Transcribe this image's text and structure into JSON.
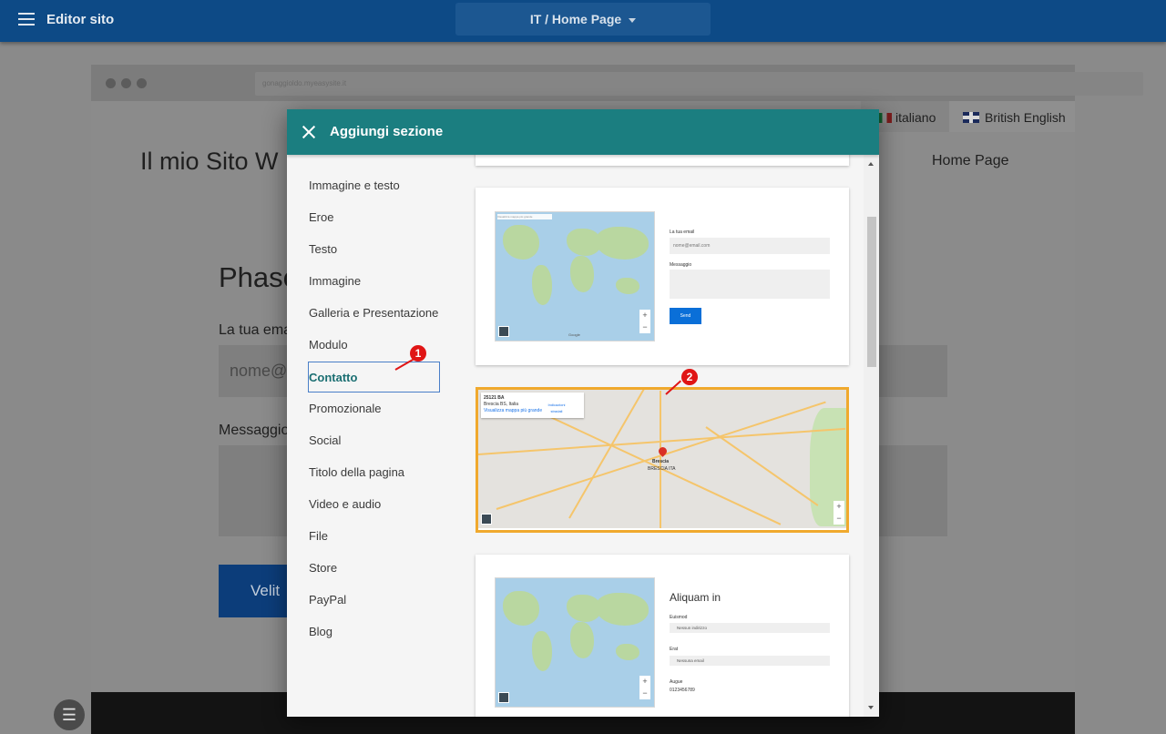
{
  "topbar": {
    "app_title": "Editor sito",
    "page_selector": "IT / Home Page"
  },
  "background": {
    "url": "gonaggioldo.myeasysite.it",
    "languages": [
      "italiano",
      "British English"
    ],
    "site_title": "Il mio Sito W",
    "nav_item": "Home Page",
    "heading": "Phase",
    "email_label": "La tua ema",
    "email_placeholder": "nome@",
    "message_label": "Messaggio",
    "button_label": "Velit"
  },
  "modal": {
    "title": "Aggiungi sezione",
    "categories": [
      "Immagine e testo",
      "Eroe",
      "Testo",
      "Immagine",
      "Galleria e Presentazione",
      "Modulo",
      "Contatto",
      "Promozionale",
      "Social",
      "Titolo della pagina",
      "Video e audio",
      "File",
      "Store",
      "PayPal",
      "Blog"
    ],
    "active_category": "Contatto",
    "card1": {
      "email_label": "La tua email",
      "email_placeholder": "nome@email.com",
      "message_label": "Messaggio",
      "send_label": "Send",
      "map_search": "Visualizza mappa più grande",
      "map_credit": "Google"
    },
    "card2": {
      "address": "25121 BA",
      "address_sub": "Brescia BS, Italia",
      "directions": "Indicazioni stradali",
      "enlarge": "Visualizza mappa più grande",
      "city_name": "Brescia",
      "district": "BRESCIA ITA"
    },
    "card3": {
      "heading": "Aliquam in",
      "row1_label": "Euismod",
      "row1_value": "Nessun indirizzo",
      "row2_label": "Erat",
      "row2_value": "Nessuna email",
      "row3_label": "Augue",
      "row3_value": "0123456789"
    }
  },
  "annotations": [
    "1",
    "2"
  ]
}
